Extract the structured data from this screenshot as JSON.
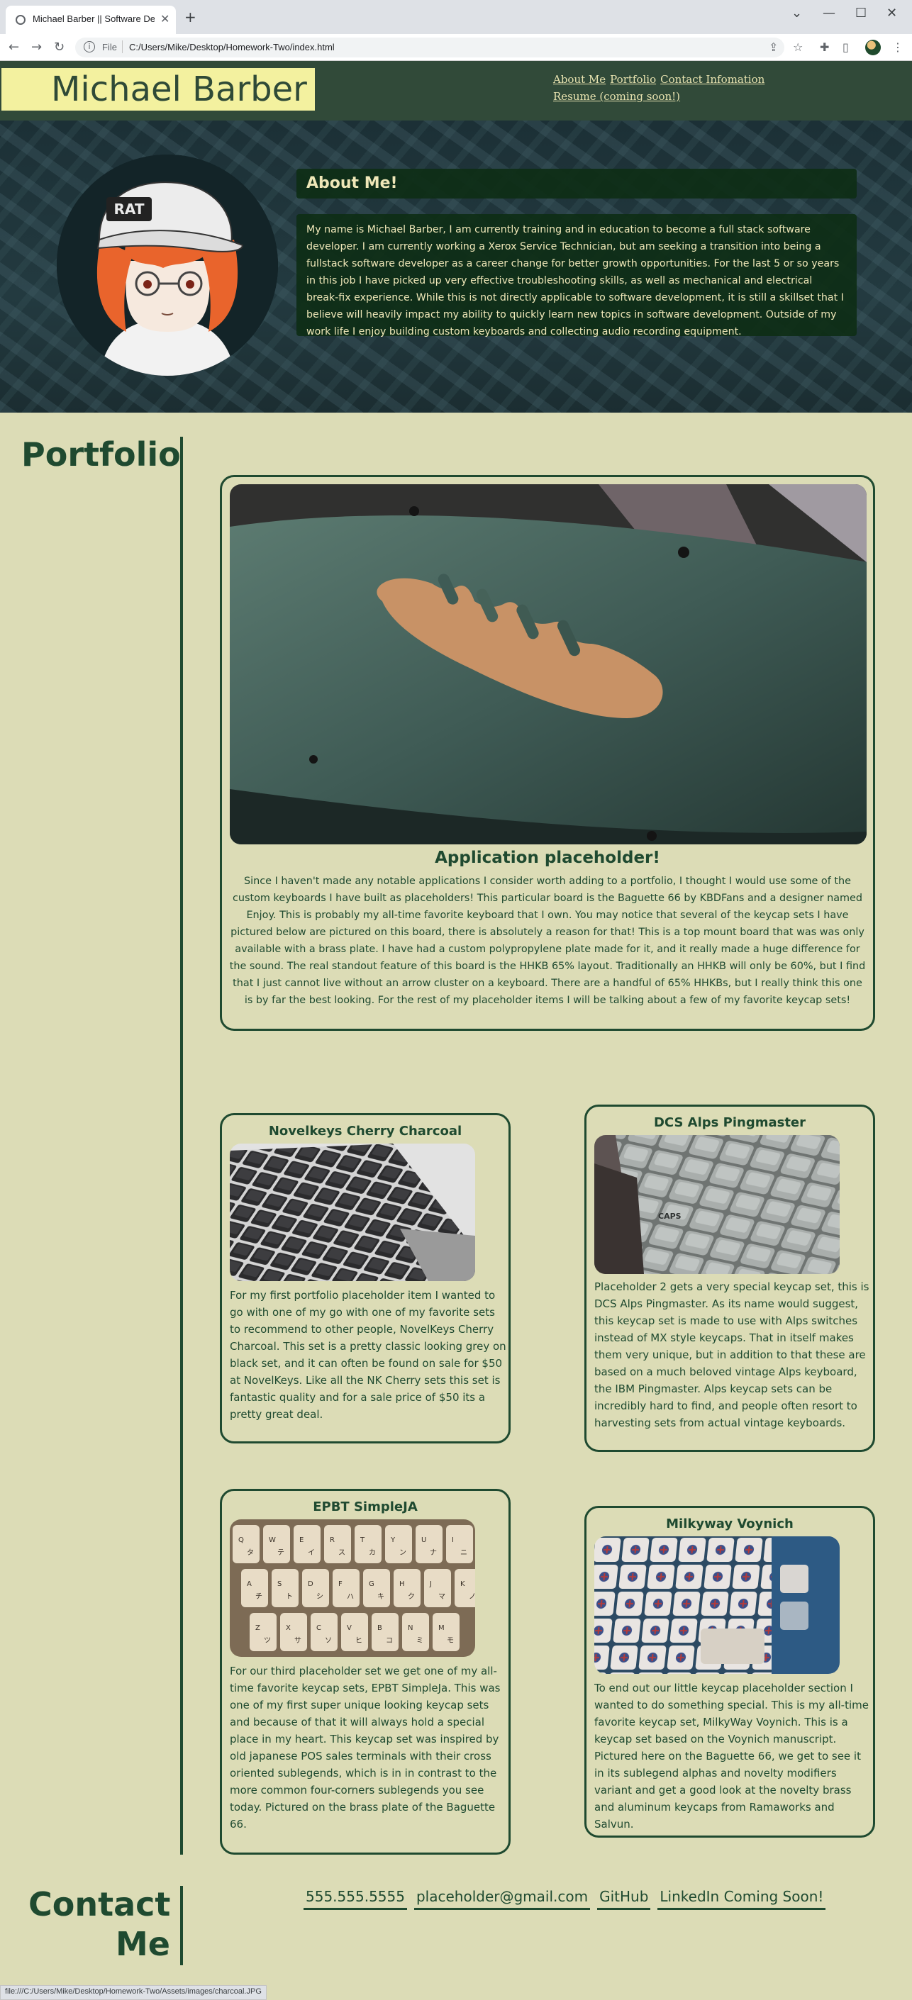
{
  "browser": {
    "tab_title": "Michael Barber || Software Devel",
    "address_scheme": "File",
    "address_url": "C:/Users/Mike/Desktop/Homework-Two/index.html",
    "status_url": "file:///C:/Users/Mike/Desktop/Homework-Two/Assets/images/charcoal.JPG"
  },
  "header": {
    "name": "Michael Barber",
    "nav": [
      {
        "label": "About Me"
      },
      {
        "label": "Portfolio"
      },
      {
        "label": "Contact Infomation"
      },
      {
        "label": "Resume (coming soon!)"
      }
    ]
  },
  "about": {
    "heading": "About Me!",
    "body": "My name is Michael Barber, I am currently training and in education to become a full stack software developer. I am currently working a Xerox Service Technician, but am seeking a transition into being a fullstack software developer as a career change for better growth opportunities. For the last 5 or so years in this job I have picked up very effective troubleshooting skills, as well as mechanical and electrical break-fix experience. While this is not directly applicable to software development, it is still a skillset that I believe will heavily impact my ability to quickly learn new topics in software development. Outside of my work life I enjoy building custom keyboards and collecting audio recording equipment."
  },
  "portfolio": {
    "title": "Portfolio",
    "featured": {
      "title": "Application placeholder!",
      "body": "Since I haven't made any notable applications I consider worth adding to a portfolio, I thought I would use some of the custom keyboards I have built as placeholders! This particular board is the Baguette 66 by KBDFans and a designer named Enjoy. This is probably my all-time favorite keyboard that I own. You may notice that several of the keycap sets I have pictured below are pictured on this board, there is absolutely a reason for that! This is a top mount board that was was only available with a brass plate. I have had a custom polypropylene plate made for it, and it really made a huge difference for the sound. The real standout feature of this board is the HHKB 65% layout. Traditionally an HHKB will only be 60%, but I find that I just cannot live without an arrow cluster on a keyboard. There are a handful of 65% HHKBs, but I really think this one is by far the best looking. For the rest of my placeholder items I will be talking about a few of my favorite keycap sets!"
    },
    "items": [
      {
        "title": "Novelkeys Cherry Charcoal",
        "body": "For my first portfolio placeholder item I wanted to go with one of my go with one of my favorite sets to recommend to other people, NovelKeys Cherry Charcoal. This set is a pretty classic looking grey on black set, and it can often be found on sale for $50 at NovelKeys. Like all the NK Cherry sets this set is fantastic quality and for a sale price of $50 its a pretty great deal."
      },
      {
        "title": "DCS Alps Pingmaster",
        "body": "Placeholder 2 gets a very special keycap set, this is DCS Alps Pingmaster. As its name would suggest, this keycap set is made to use with Alps switches instead of MX style keycaps. That in itself makes them very unique, but in addition to that these are based on a much beloved vintage Alps keyboard, the IBM Pingmaster. Alps keycap sets can be incredibly hard to find, and people often resort to harvesting sets from actual vintage keyboards."
      },
      {
        "title": "EPBT SimpleJA",
        "body": "For our third placeholder set we get one of my all-time favorite keycap sets, EPBT SimpleJa. This was one of my first super unique looking keycap sets and because of that it will always hold a special place in my heart. This keycap set was inspired by old japanese POS sales terminals with their cross oriented sublegends, which is in in contrast to the more common four-corners sublegends you see today. Pictured on the brass plate of the Baguette 66."
      },
      {
        "title": "Milkyway Voynich",
        "body": "To end out our little keycap placeholder section I wanted to do something special. This is my all-time favorite keycap set, MilkyWay Voynich. This is a keycap set based on the Voynich manuscript. Pictured here on the Baguette 66, we get to see it in its sublegend alphas and novelty modifiers variant and get a good look at the novelty brass and aluminum keycaps from Ramaworks and Salvun."
      }
    ],
    "photo_legends": {
      "baguette_logo": "",
      "pingmaster_key": "CAPS",
      "simpleja_rows": [
        "Q W E R T Y U I",
        "A S D F G H J K",
        "Z X C V B N M"
      ],
      "simpleja_kana": [
        "タ テ イ ス カ ン ナ ニ",
        "チ ト シ ハ キ ク マ ノ",
        "ツ サ ソ ヒ コ ミ モ"
      ]
    }
  },
  "contact": {
    "title_line1": "Contact",
    "title_line2": "Me",
    "links": [
      "555.555.5555",
      "placeholder@gmail.com",
      "GitHub",
      "LinkedIn Coming Soon!"
    ]
  }
}
